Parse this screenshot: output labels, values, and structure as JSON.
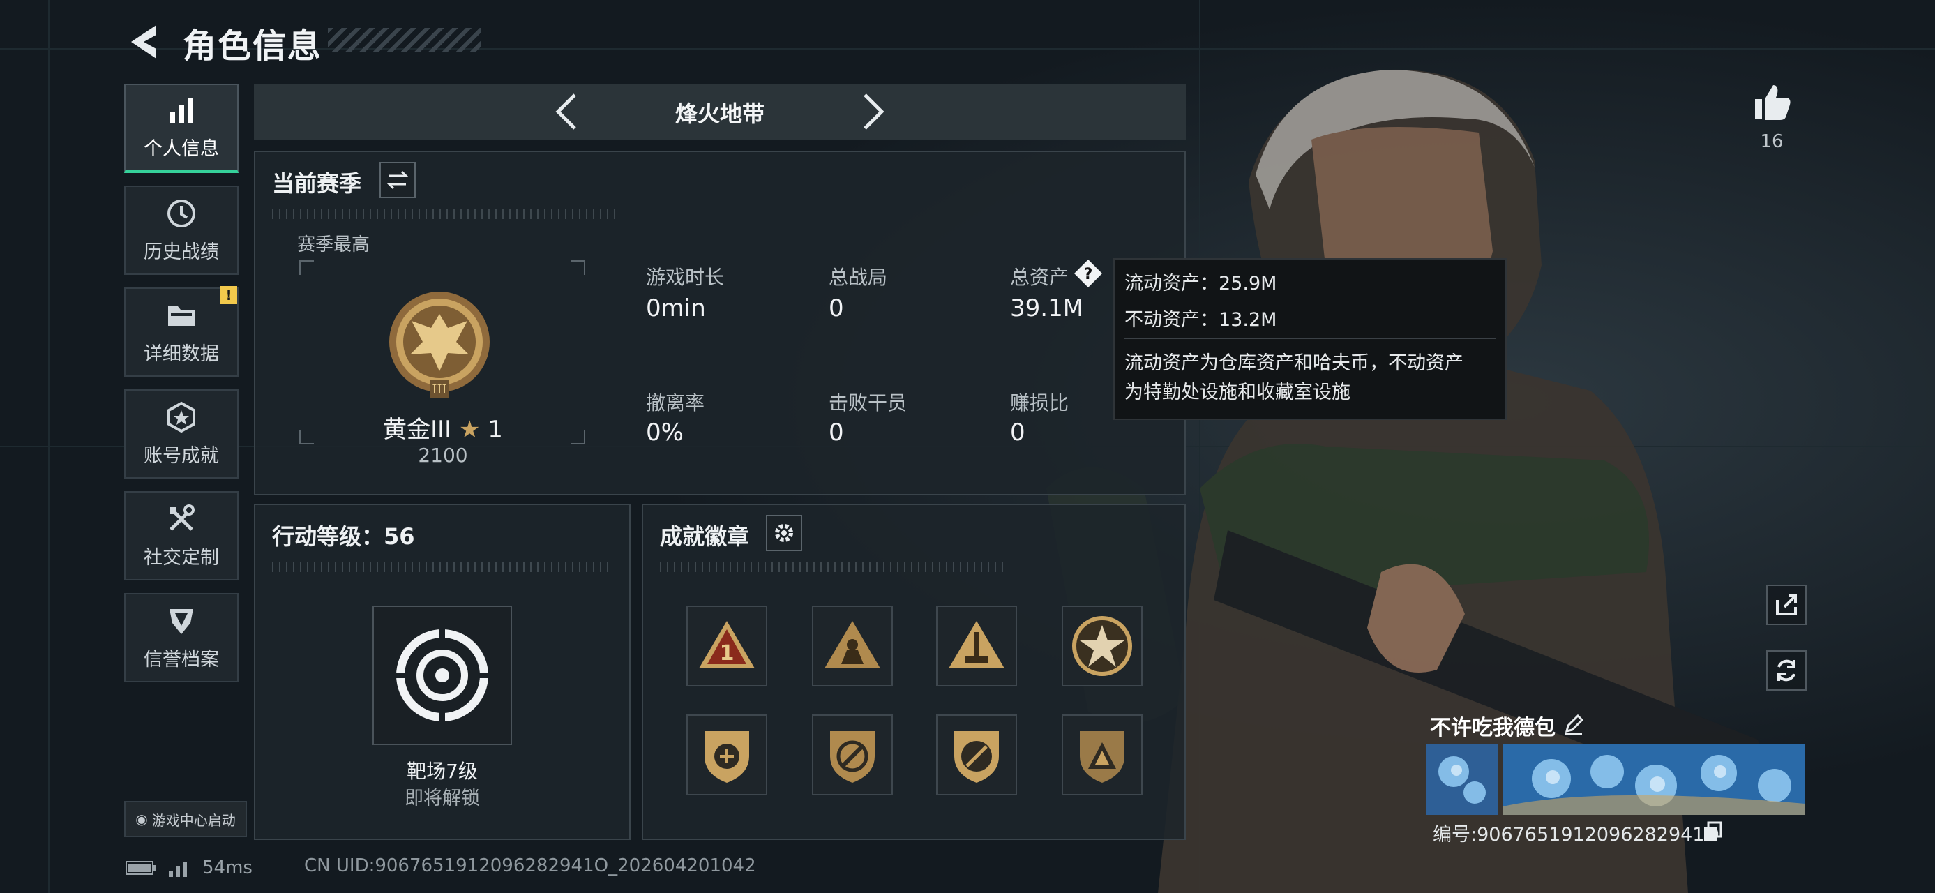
{
  "header": {
    "title": "角色信息"
  },
  "sidebar": {
    "items": [
      {
        "label": "个人信息",
        "icon": "bar-chart-icon",
        "active": true
      },
      {
        "label": "历史战绩",
        "icon": "clock-icon"
      },
      {
        "label": "详细数据",
        "icon": "folder-icon",
        "alert": "!"
      },
      {
        "label": "账号成就",
        "icon": "achievement-icon"
      },
      {
        "label": "社交定制",
        "icon": "tools-icon"
      },
      {
        "label": "信誉档案",
        "icon": "credit-shield-icon"
      }
    ],
    "launch_label": "游戏中心启动"
  },
  "status": {
    "ping": "54ms",
    "uid": "CN UID:9067651912096282941O_202604201042"
  },
  "mode": {
    "name": "烽火地带"
  },
  "season": {
    "title": "当前赛季",
    "best_label": "赛季最高",
    "rank_name": "黄金III",
    "rank_stars": "1",
    "rank_score": "2100",
    "stats": [
      {
        "label": "游戏时长",
        "value": "0min"
      },
      {
        "label": "总战局",
        "value": "0"
      },
      {
        "label": "总资产",
        "value": "39.1M"
      },
      {
        "label": "撤离率",
        "value": "0%"
      },
      {
        "label": "击败干员",
        "value": "0"
      },
      {
        "label": "赚损比",
        "value": "0"
      }
    ]
  },
  "tooltip": {
    "liquid": "流动资产：25.9M",
    "fixed": "不动资产：13.2M",
    "desc_line1": "流动资产为仓库资产和哈夫币，不动资产",
    "desc_line2": "为特勤处设施和收藏室设施"
  },
  "action_level": {
    "title": "行动等级：56",
    "level_name": "靶场7级",
    "level_sub": "即将解锁"
  },
  "achievements": {
    "title": "成就徽章",
    "badges": [
      "triangle-1-badge-icon",
      "squad-triangle-badge-icon",
      "rocket-triangle-badge-icon",
      "star-badge-icon",
      "shield-wings-badge-icon",
      "shield-slash-badge-icon",
      "shield-circle-badge-icon",
      "shield-triangle-badge-icon"
    ]
  },
  "player": {
    "likes": "16",
    "name": "不许吃我德包",
    "id": "编号:9067651912096282941O"
  },
  "colors": {
    "accent": "#35d19a",
    "gold": "#c9a361",
    "background": "#131a20"
  }
}
